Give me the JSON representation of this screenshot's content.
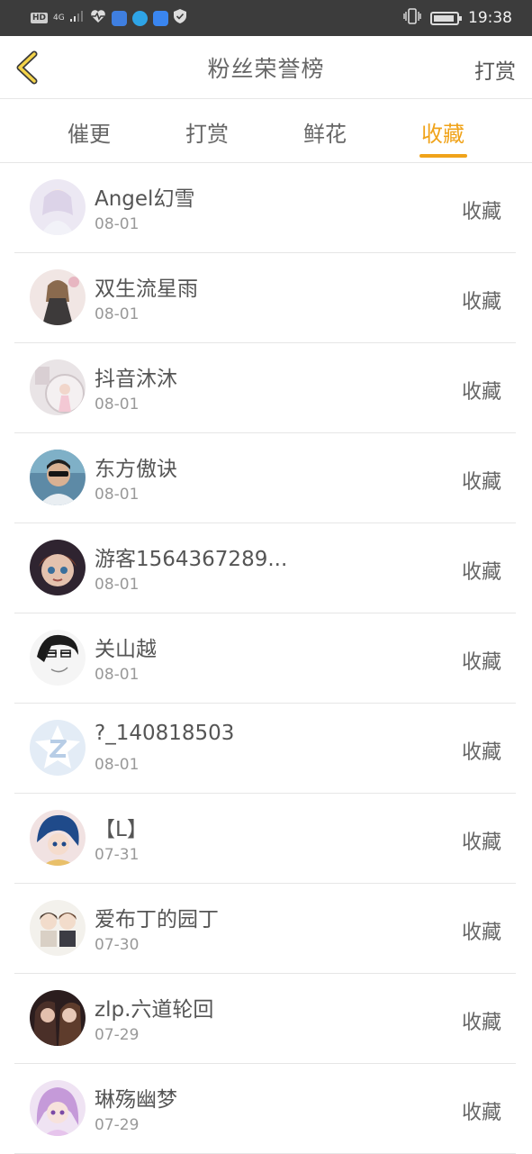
{
  "status_bar": {
    "hd": "HD",
    "network": "4G",
    "time": "19:38"
  },
  "header": {
    "title": "粉丝荣誉榜",
    "right_action": "打赏"
  },
  "tabs": [
    {
      "label": "催更",
      "active": false
    },
    {
      "label": "打赏",
      "active": false
    },
    {
      "label": "鲜花",
      "active": false
    },
    {
      "label": "收藏",
      "active": true
    }
  ],
  "colors": {
    "accent": "#f0a31a",
    "statusbar": "#3c3c3c"
  },
  "fans": [
    {
      "name": "Angel幻雪",
      "date": "08-01",
      "action": "收藏",
      "avatar": "avatar-white-dress-girl"
    },
    {
      "name": "双生流星雨",
      "date": "08-01",
      "action": "收藏",
      "avatar": "avatar-doll-girl"
    },
    {
      "name": "抖音沐沐",
      "date": "08-01",
      "action": "收藏",
      "avatar": "avatar-photo-girl"
    },
    {
      "name": "东方傲诀",
      "date": "08-01",
      "action": "收藏",
      "avatar": "avatar-sunglasses-man"
    },
    {
      "name": "游客1564367289...",
      "date": "08-01",
      "action": "收藏",
      "avatar": "avatar-doll-face"
    },
    {
      "name": "关山越",
      "date": "08-01",
      "action": "收藏",
      "avatar": "avatar-anime-glasses"
    },
    {
      "name": "?_140818503",
      "date": "08-01",
      "action": "收藏",
      "avatar": "avatar-qq-default"
    },
    {
      "name": "【L】",
      "date": "07-31",
      "action": "收藏",
      "avatar": "avatar-anime-blue-hair"
    },
    {
      "name": "爱布丁的园丁",
      "date": "07-30",
      "action": "收藏",
      "avatar": "avatar-chibi-pair"
    },
    {
      "name": "zlp.六道轮回",
      "date": "07-29",
      "action": "收藏",
      "avatar": "avatar-two-girls"
    },
    {
      "name": "琳殇幽梦",
      "date": "07-29",
      "action": "收藏",
      "avatar": "avatar-purple-hair-girl"
    }
  ]
}
